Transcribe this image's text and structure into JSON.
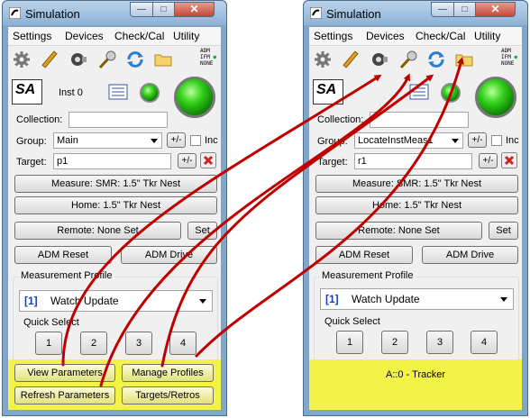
{
  "colors": {
    "accent_yellow": "#f3f347",
    "arrow_red": "#c00000",
    "led_green": "#33d11a",
    "title_bar": "#9fc0e0"
  },
  "left_window": {
    "title": "Simulation",
    "title_buttons": {
      "minimize": "—",
      "maximize": "□",
      "close": "✕"
    },
    "menu": [
      "Settings",
      "Devices",
      "Check/Cal",
      "Utility"
    ],
    "toolbar_icons": [
      "gear-icon",
      "laser-icon",
      "tracker-icon",
      "target-icon",
      "refresh-icon",
      "folder-icon"
    ],
    "adm_status": {
      "line1": "ADM",
      "line2": "IFM",
      "line3": "NONE"
    },
    "inst_label": "Inst 0",
    "logo_text": "SA",
    "collection_label": "Collection:",
    "collection_value": "",
    "group_label": "Group:",
    "group_value": "Main",
    "plus_minus": "+/-",
    "inc_label": "Inc",
    "target_label": "Target:",
    "target_value": "p1",
    "measure_btn": "Measure: SMR: 1.5\" Tkr Nest",
    "home_btn": "Home: 1.5\" Tkr Nest",
    "remote_btn": "Remote: None Set",
    "set_btn": "Set",
    "adm_reset_btn": "ADM Reset",
    "adm_drive_btn": "ADM Drive",
    "profile_group_label": "Measurement Profile",
    "profile_index": "[1]",
    "profile_value": "Watch Update",
    "quick_select_label": "Quick Select",
    "quick_buttons": [
      "1",
      "2",
      "3",
      "4"
    ],
    "view_params_btn": "View Parameters",
    "manage_profiles_btn": "Manage Profiles",
    "refresh_params_btn": "Refresh Parameters",
    "targets_btn": "Targets/Retros"
  },
  "right_window": {
    "title": "Simulation",
    "title_buttons": {
      "minimize": "—",
      "maximize": "□",
      "close": "✕"
    },
    "menu": [
      "Settings",
      "Devices",
      "Check/Cal",
      "Utility"
    ],
    "toolbar_icons": [
      "gear-icon",
      "laser-icon",
      "tracker-icon",
      "target-icon",
      "refresh-icon",
      "folder-icon"
    ],
    "adm_status": {
      "line1": "ADM",
      "line2": "IFM",
      "line3": "NONE"
    },
    "logo_text": "SA",
    "collection_label": "Collection:",
    "collection_value": "",
    "group_label": "Group:",
    "group_value": "LocateInstMeas1",
    "plus_minus": "+/-",
    "inc_label": "Inc",
    "target_label": "Target:",
    "target_value": "r1",
    "measure_btn": "Measure: SMR: 1.5\" Tkr Nest",
    "home_btn": "Home: 1.5\" Tkr Nest",
    "remote_btn": "Remote: None Set",
    "set_btn": "Set",
    "adm_reset_btn": "ADM Reset",
    "adm_drive_btn": "ADM Drive",
    "profile_group_label": "Measurement Profile",
    "profile_index": "[1]",
    "profile_value": "Watch Update",
    "quick_select_label": "Quick Select",
    "quick_buttons": [
      "1",
      "2",
      "3",
      "4"
    ],
    "status_text": "A::0 - Tracker"
  }
}
